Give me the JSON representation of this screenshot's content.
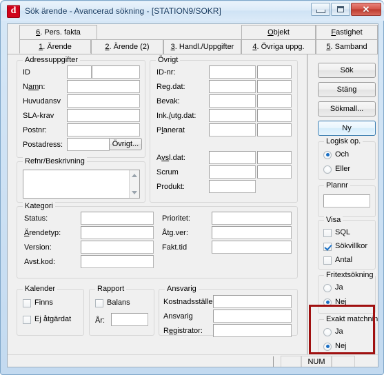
{
  "window": {
    "title": "Sök ärende - Avancerad sökning - [STATION9/SOKR]",
    "icon": "app-d-icon",
    "minimize_label": "",
    "maximize_label": "",
    "close_label": "✕"
  },
  "tabs": {
    "row1": [
      {
        "label": "6. Pers. fakta",
        "accel": "6"
      },
      {
        "label": "Objekt",
        "accel": "O"
      },
      {
        "label": "Fastighet",
        "accel": "F"
      }
    ],
    "row2": [
      {
        "label": "1. Ärende",
        "accel": "1",
        "active": true
      },
      {
        "label": "2. Ärende (2)",
        "accel": "2",
        "active": false
      },
      {
        "label": "3. Handl./Uppgifter",
        "accel": "3",
        "active": false
      },
      {
        "label": "4. Övriga uppg.",
        "accel": "4",
        "active": false
      },
      {
        "label": "5. Samband",
        "accel": "5",
        "active": false
      }
    ]
  },
  "groups": {
    "adressuppgifter": {
      "legend": "Adressuppgifter",
      "fields": [
        {
          "label": "ID",
          "value": "",
          "value2": ""
        },
        {
          "label": "Namn:",
          "value": ""
        },
        {
          "label": "Huvudansv",
          "value": ""
        },
        {
          "label": "SLA-krav",
          "value": ""
        },
        {
          "label": "Postnr:",
          "value": ""
        },
        {
          "label": "Postadress:",
          "value": ""
        }
      ],
      "button": "Övrigt..."
    },
    "refnr": {
      "legend": "Refnr/Beskrivning",
      "value": ""
    },
    "kategori": {
      "legend": "Kategori",
      "left": [
        {
          "label": "Status:",
          "value": ""
        },
        {
          "label": "Ärendetyp:",
          "value": ""
        },
        {
          "label": "Version:",
          "value": ""
        },
        {
          "label": "Avst.kod:",
          "value": ""
        }
      ],
      "right": [
        {
          "label": "Prioritet:",
          "value": ""
        },
        {
          "label": "Åtg.ver:",
          "value": ""
        },
        {
          "label": "Fakt.tid",
          "value": ""
        }
      ]
    },
    "kalender": {
      "legend": "Kalender",
      "checks": [
        {
          "label": "Finns",
          "checked": false
        },
        {
          "label": "Ej åtgärdat",
          "checked": false
        }
      ]
    },
    "rapport": {
      "legend": "Rapport",
      "checks": [
        {
          "label": "Balans",
          "checked": false
        }
      ],
      "year_label": "År:",
      "year_value": ""
    },
    "ansvarig": {
      "legend": "Ansvarig",
      "fields": [
        {
          "label": "Kostnadsställe",
          "value": ""
        },
        {
          "label": "Ansvarig",
          "value": ""
        },
        {
          "label": "Registrator:",
          "value": ""
        }
      ]
    },
    "ovrigt": {
      "legend": "Övrigt",
      "fields": [
        {
          "label": "ID-nr:",
          "value": "",
          "value2": ""
        },
        {
          "label": "Reg.dat:",
          "value": "",
          "value2": ""
        },
        {
          "label": "Bevak:",
          "value": "",
          "value2": ""
        },
        {
          "label": "Ink./utg.dat:",
          "value": "",
          "value2": ""
        },
        {
          "label": "Planerat",
          "value": "",
          "value2": ""
        },
        {
          "label": "Avsl.dat:",
          "value": "",
          "value2": ""
        },
        {
          "label": "Scrum",
          "value": "",
          "value2": ""
        },
        {
          "label": "Produkt:",
          "value": ""
        }
      ]
    },
    "logisk_op": {
      "legend": "Logisk op.",
      "options": [
        {
          "label": "Och",
          "selected": true
        },
        {
          "label": "Eller",
          "selected": false
        }
      ]
    },
    "plannr": {
      "legend": "Plannr",
      "value": ""
    },
    "visa": {
      "legend": "Visa",
      "checks": [
        {
          "label": "SQL",
          "checked": false
        },
        {
          "label": "Sökvillkor",
          "checked": true
        },
        {
          "label": "Antal",
          "checked": false
        }
      ]
    },
    "fritextsokning": {
      "legend": "Fritextsökning",
      "options": [
        {
          "label": "Ja",
          "selected": false
        },
        {
          "label": "Nej",
          "selected": true
        }
      ]
    },
    "exakt_matchning": {
      "legend": "Exakt matchning",
      "options": [
        {
          "label": "Ja",
          "selected": false
        },
        {
          "label": "Nej",
          "selected": true
        }
      ],
      "highlighted": true,
      "highlight_color": "#a01010"
    }
  },
  "buttons": {
    "sok": "Sök",
    "stang": "Stäng",
    "sokmall": "Sökmall...",
    "ny": "Ny"
  },
  "statusbar": {
    "message": "",
    "num_indicator": "NUM"
  }
}
